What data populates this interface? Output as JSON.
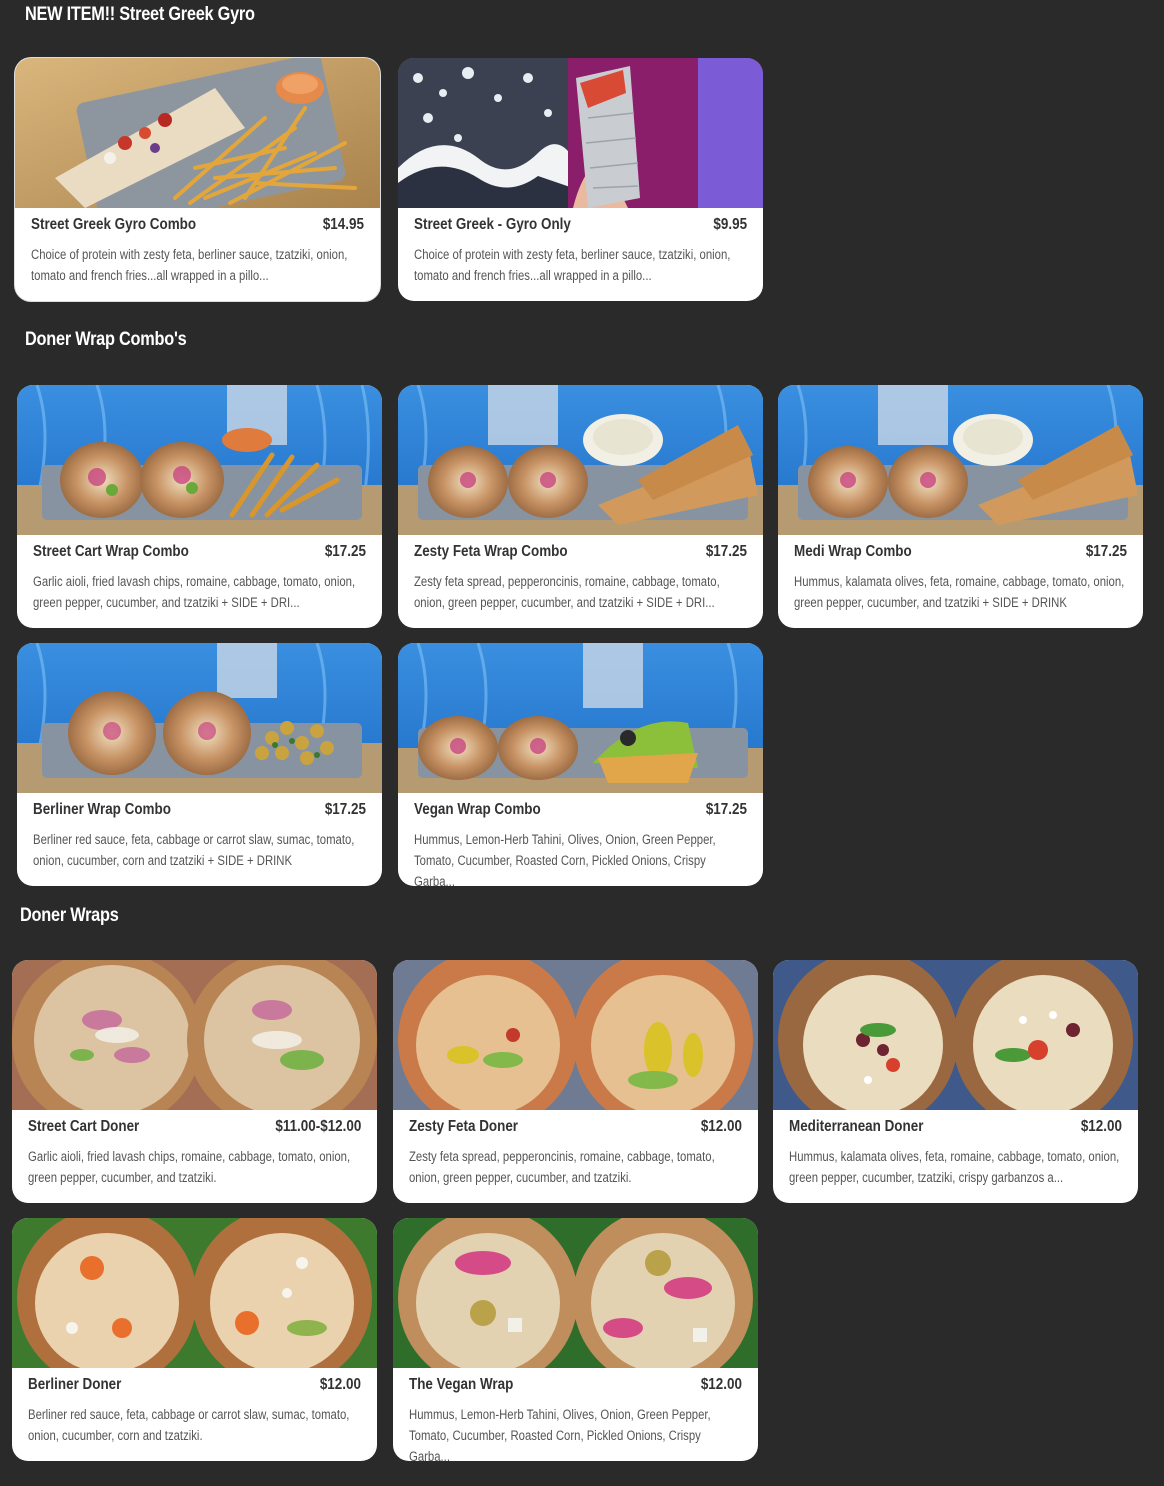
{
  "sections": [
    {
      "title": "NEW ITEM!! Street Greek Gyro",
      "items": [
        {
          "name": "Street Greek Gyro Combo",
          "price": "$14.95",
          "description": "Choice of protein with zesty feta, berliner sauce, tzatziki, onion, tomato and french fries...all wrapped in a pillo..."
        },
        {
          "name": "Street Greek - Gyro Only",
          "price": "$9.95",
          "description": "Choice of protein with zesty feta, berliner sauce, tzatziki, onion, tomato and french fries...all wrapped in a pillo..."
        }
      ]
    },
    {
      "title": "Doner Wrap Combo's",
      "items": [
        {
          "name": "Street Cart Wrap Combo",
          "price": "$17.25",
          "description": "Garlic aioli, fried lavash chips, romaine, cabbage, tomato, onion, green pepper, cucumber, and tzatziki + SIDE + DRI..."
        },
        {
          "name": "Zesty Feta Wrap Combo",
          "price": "$17.25",
          "description": "Zesty feta spread, pepperoncinis, romaine, cabbage, tomato, onion, green pepper, cucumber, and tzatziki + SIDE + DRI..."
        },
        {
          "name": "Medi Wrap Combo",
          "price": "$17.25",
          "description": "Hummus, kalamata olives, feta, romaine, cabbage, tomato, onion, green pepper, cucumber, and tzatziki + SIDE + DRINK"
        },
        {
          "name": "Berliner Wrap Combo",
          "price": "$17.25",
          "description": "Berliner red sauce, feta, cabbage or carrot slaw, sumac, tomato, onion, cucumber, corn and tzatziki + SIDE + DRINK"
        },
        {
          "name": "Vegan Wrap Combo",
          "price": "$17.25",
          "description": "Hummus, Lemon-Herb Tahini, Olives, Onion, Green Pepper, Tomato, Cucumber, Roasted Corn, Pickled Onions, Crispy Garba..."
        }
      ]
    },
    {
      "title": "Doner Wraps",
      "items": [
        {
          "name": "Street Cart Doner",
          "price": "$11.00-$12.00",
          "description": "Garlic aioli, fried lavash chips, romaine, cabbage, tomato, onion, green pepper, cucumber, and tzatziki."
        },
        {
          "name": "Zesty Feta Doner",
          "price": "$12.00",
          "description": "Zesty feta spread, pepperoncinis, romaine, cabbage, tomato, onion, green pepper, cucumber, and tzatziki."
        },
        {
          "name": "Mediterranean Doner",
          "price": "$12.00",
          "description": "Hummus, kalamata olives, feta, romaine, cabbage, tomato, onion, green pepper, cucumber, tzatziki, crispy garbanzos a..."
        },
        {
          "name": "Berliner Doner",
          "price": "$12.00",
          "description": "Berliner red sauce, feta, cabbage or carrot slaw, sumac, tomato, onion, cucumber, corn and tzatziki."
        },
        {
          "name": "The Vegan Wrap",
          "price": "$12.00",
          "description": "Hummus, Lemon-Herb Tahini, Olives, Onion, Green Pepper, Tomato, Cucumber, Roasted Corn, Pickled Onions, Crispy Garba..."
        }
      ]
    }
  ],
  "colors": {
    "page_background": "#2a2a2a",
    "card_background": "#ffffff",
    "title_text": "#ffffff",
    "item_text": "#333333",
    "description_text": "#555555"
  }
}
